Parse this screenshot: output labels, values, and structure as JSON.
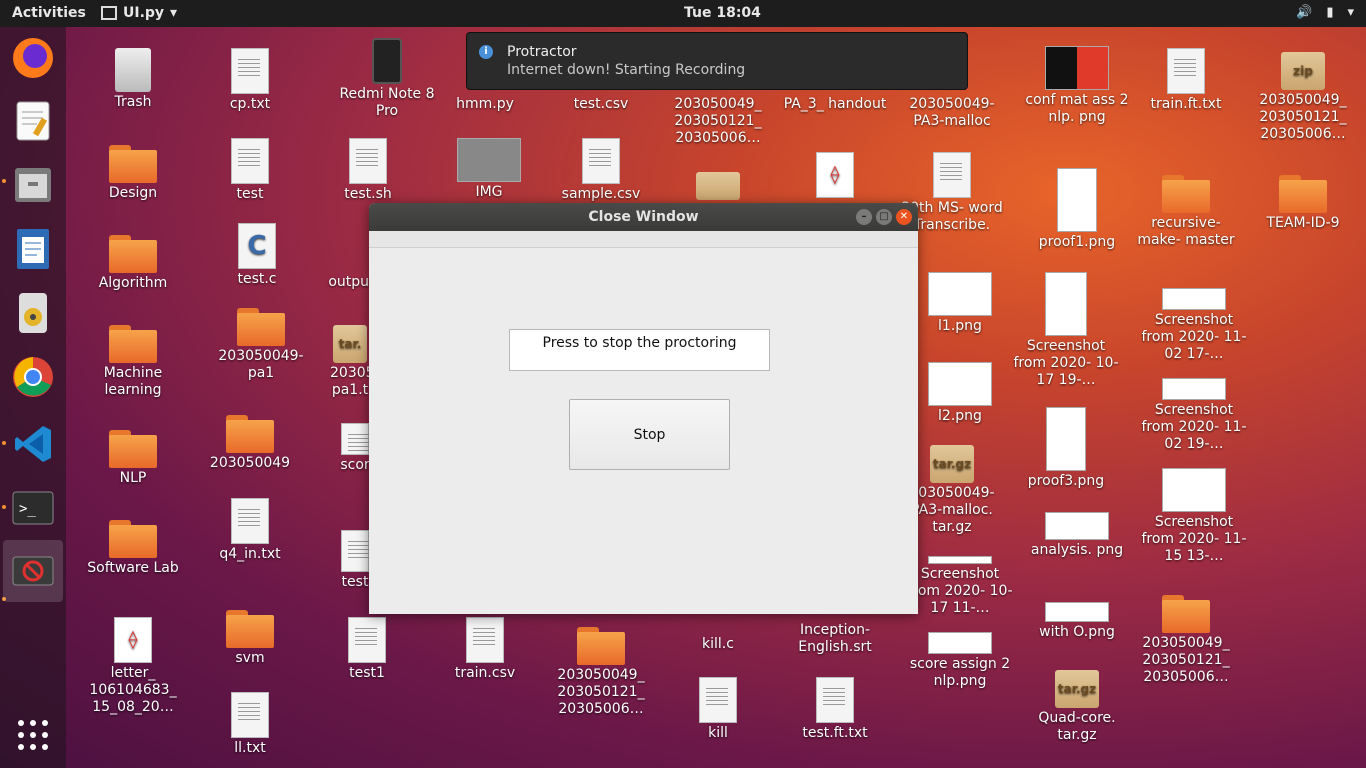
{
  "topbar": {
    "activities": "Activities",
    "app_name": "UI.py",
    "clock": "Tue 18:04"
  },
  "notification": {
    "title": "Protractor",
    "body": "Internet down! Starting Recording"
  },
  "window": {
    "title": "Close Window",
    "label": "Press to stop the proctoring",
    "stop_button": "Stop"
  },
  "desktop_icons": {
    "trash": "Trash",
    "design": "Design",
    "algorithm": "Algorithm",
    "machine_learning": "Machine learning",
    "nlp": "NLP",
    "software_lab": "Software Lab",
    "letter": "letter_ 106104683_ 15_08_20…",
    "cp_txt": "cp.txt",
    "test": "test",
    "test_c": "test.c",
    "pa1": "203050049- pa1",
    "d203050049": "203050049",
    "q4_in": "q4_in.txt",
    "svm": "svm",
    "ll_txt": "ll.txt",
    "redmi": "Redmi Note 8 Pro",
    "test_sh": "test.sh",
    "outpu": "outpu",
    "pa1_t": "20305 pa1.t",
    "scor": "scor",
    "test_cut": "test",
    "test1": "test1",
    "hmm": "hmm.py",
    "img": "IMG",
    "train_csv": "train.csv",
    "test_csv": "test.csv",
    "sample_csv": "sample.csv",
    "d203050049_b": "203050049_ 203050121_ 20305006…",
    "d203050049_c": "203050049_ 203050121_ 20305006…",
    "kill_c": "kill.c",
    "kill": "kill",
    "pa3_handout": "PA_3_ handout",
    "inception": "Inception- English.srt",
    "test_ft": "test.ft.txt",
    "pa3_malloc": "203050049- PA3-malloc",
    "ms_word": "30th MS- word Transcribe.",
    "l1": "l1.png",
    "l2": "l2.png",
    "pa3_malloc_tar": "203050049- PA3-malloc. tar.gz",
    "ss_1017_11": "Screenshot from 2020- 10-17 11-…",
    "score_assign": "score assign 2 nlp.png",
    "conf_mat": "conf mat ass 2 nlp. png",
    "proof1": "proof1.png",
    "ss_1017_19": "Screenshot from 2020- 10-17 19-…",
    "proof3": "proof3.png",
    "analysis": "analysis. png",
    "with_o": "with O.png",
    "quad_core": "Quad-core. tar.gz",
    "train_ft": "train.ft.txt",
    "recursive": "recursive- make- master",
    "ss_1102_17": "Screenshot from 2020- 11-02 17-…",
    "ss_1102_19": "Screenshot from 2020- 11-02 19-…",
    "ss_1115_13": "Screenshot from 2020- 11-15 13-…",
    "d203050049_d": "203050049_ 203050121_ 20305006…",
    "zip_item": "203050049_ 203050121_ 20305006…",
    "team": "TEAM-ID-9",
    "zip_label": "zip",
    "tar_label": "tar.gz",
    "tar_short": "tar."
  },
  "colors": {
    "accent": "#e95420",
    "folder": "#f29030"
  }
}
